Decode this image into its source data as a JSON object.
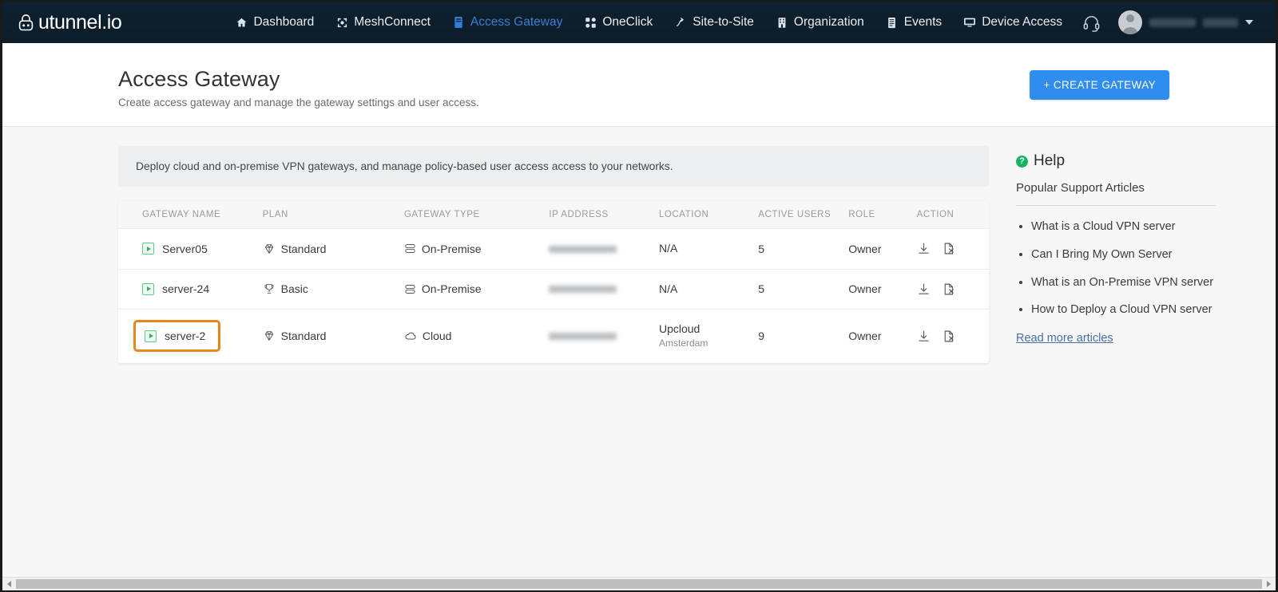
{
  "brand": {
    "name": "utunnel.io",
    "logo_icon": "lock-shield-icon"
  },
  "nav": {
    "items": [
      {
        "label": "Dashboard",
        "icon": "home-icon",
        "active": false
      },
      {
        "label": "MeshConnect",
        "icon": "mesh-nodes-icon",
        "active": false
      },
      {
        "label": "Access Gateway",
        "icon": "gateway-icon",
        "active": true
      },
      {
        "label": "OneClick",
        "icon": "grid-dots-icon",
        "active": false
      },
      {
        "label": "Site-to-Site",
        "icon": "branch-arrow-icon",
        "active": false
      },
      {
        "label": "Organization",
        "icon": "building-icon",
        "active": false
      },
      {
        "label": "Events",
        "icon": "list-log-icon",
        "active": false
      },
      {
        "label": "Device Access",
        "icon": "monitor-icon",
        "active": false
      }
    ],
    "support_icon": "headset-icon",
    "account": {
      "avatar_icon": "user-avatar-icon",
      "name_redacted": true,
      "caret_icon": "chevron-down-icon"
    }
  },
  "header": {
    "title": "Access Gateway",
    "subtitle": "Create access gateway and manage the gateway settings and user access.",
    "create_button": "+ CREATE GATEWAY",
    "create_button_color": "#2f8ded"
  },
  "banner": {
    "text": "Deploy cloud and on-premise VPN gateways, and manage policy-based user access access to your networks."
  },
  "table": {
    "columns": [
      "GATEWAY NAME",
      "PLAN",
      "GATEWAY TYPE",
      "IP ADDRESS",
      "LOCATION",
      "ACTIVE USERS",
      "ROLE",
      "ACTION"
    ],
    "rows": [
      {
        "status_icon": "play-status-icon",
        "name": "Server05",
        "plan": "Standard",
        "plan_icon": "diamond-icon",
        "type": "On-Premise",
        "type_icon": "server-stack-icon",
        "ip": "",
        "ip_redacted": true,
        "location": "N/A",
        "location_sub": "",
        "active_users": "5",
        "role": "Owner",
        "actions": [
          "download-icon",
          "file-remove-icon"
        ],
        "highlighted": false
      },
      {
        "status_icon": "play-status-icon",
        "name": "server-24",
        "plan": "Basic",
        "plan_icon": "trophy-icon",
        "type": "On-Premise",
        "type_icon": "server-stack-icon",
        "ip": "",
        "ip_redacted": true,
        "location": "N/A",
        "location_sub": "",
        "active_users": "5",
        "role": "Owner",
        "actions": [
          "download-icon",
          "file-remove-icon"
        ],
        "highlighted": false
      },
      {
        "status_icon": "play-status-icon",
        "name": "server-2",
        "plan": "Standard",
        "plan_icon": "diamond-icon",
        "type": "Cloud",
        "type_icon": "cloud-icon",
        "ip": "",
        "ip_redacted": true,
        "location": "Upcloud",
        "location_sub": "Amsterdam",
        "active_users": "9",
        "role": "Owner",
        "actions": [
          "download-icon",
          "file-remove-icon"
        ],
        "highlighted": true,
        "highlight_color": "#e8861a"
      }
    ]
  },
  "help": {
    "icon": "question-circle-icon",
    "title": "Help",
    "subtitle": "Popular Support Articles",
    "articles": [
      "What is a Cloud VPN server",
      "Can I Bring My Own Server",
      "What is an On-Premise VPN server",
      "How to Deploy a Cloud VPN server"
    ],
    "read_more": "Read more articles"
  }
}
